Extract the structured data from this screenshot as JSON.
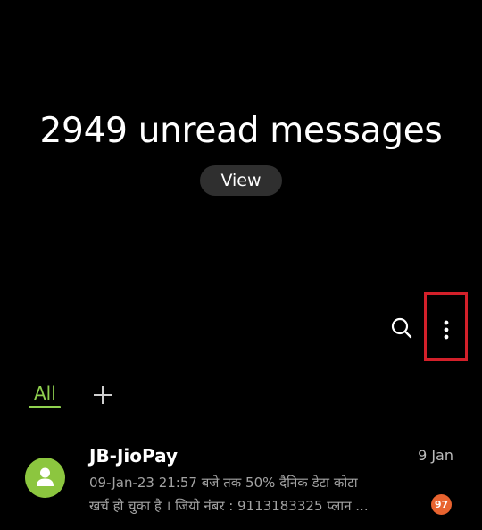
{
  "header": {
    "title": "2949 unread messages",
    "view_label": "View"
  },
  "toolbar": {
    "search_icon": "search-icon",
    "more_icon": "more-options-icon"
  },
  "tabs": [
    {
      "label": "All",
      "selected": true
    }
  ],
  "add_tab_icon": "plus-icon",
  "colors": {
    "accent": "#8fd14f",
    "avatar": "#8cc63f",
    "badge": "#e8632f",
    "highlight_box": "#d3202a"
  },
  "conversations": [
    {
      "sender": "JB-JioPay",
      "date": "9 Jan",
      "preview_line1": "09-Jan-23 21:57 बजे तक 50% दैनिक डेटा कोटा",
      "preview_line2": "खर्च हो चुका है । जियो नंबर : 9113183325 प्लान ...",
      "unread_count": "97",
      "avatar_icon": "person-icon"
    }
  ]
}
